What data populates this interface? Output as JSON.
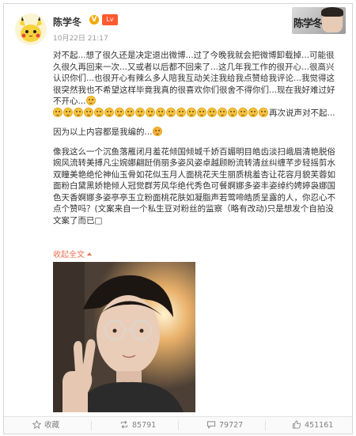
{
  "post": {
    "author": "陈学冬",
    "v_badge": "V",
    "level_badge": "Lv",
    "time": "10月22日 21:17",
    "watermark": "陈学冬"
  },
  "content": {
    "line1": "对不起...想了很久还是决定退出微博...过了今晚我就会把微博卸载掉...可能很久很久再回来一次...又或者以后都不回来了...这几年我工作的很开心...很高兴认识你们...也很开心有辣么多人陪我互动关注我给我点赞给我评论...我觉得这很突然我也不希望这样毕竟我真的很喜欢你们很舍不得你们...现在我好难过好不开心...",
    "line1_tail": "再次说声对不起...",
    "line2": "因为以上内容都是我编的...",
    "line3": "像我这么一个沉鱼落雁闭月羞花倾国倾城千娇百媚明目皓齿淡扫峨眉清艳脱俗婉风流转美搏凡尘婉娜翩跹俏丽多姿风姿卓越顾盼流转清丝纠缠芊步轻摇剪水双瞳美艳绝伦神仙玉骨如花似玉月人面桃花天生丽质桃羞杏让花容月貌芙蓉如面粉白黛黑娇艳倾人冠觉群芳风华绝代秀色可餐婀娜多姿丰姿绰约娉婷袅娜国色天香婀娜多姿亭亭玉立粉面桃花肤如凝脂声若莺啼皓质呈露的人，你忍心不点个赞吗？(文案来自一个私生豆对粉丝的监察（略有改动)只是想发个自拍没文案了而已□",
    "collapse_label": "收起全文"
  },
  "footer": {
    "favorite_label": "收藏",
    "repost_count": "85791",
    "comment_count": "79727",
    "like_count": "451161"
  },
  "colors": {
    "link": "#eb7350",
    "muted": "#999999",
    "emoji_fill": "#f6c341"
  },
  "icons": {
    "avatar": "pikachu-avatar",
    "favorite": "star-icon",
    "repost": "repost-icon",
    "comment": "comment-icon",
    "like": "thumbs-up-icon",
    "emoji": "crying-face-emoji",
    "emoji_tail": "smirk-face-emoji"
  }
}
